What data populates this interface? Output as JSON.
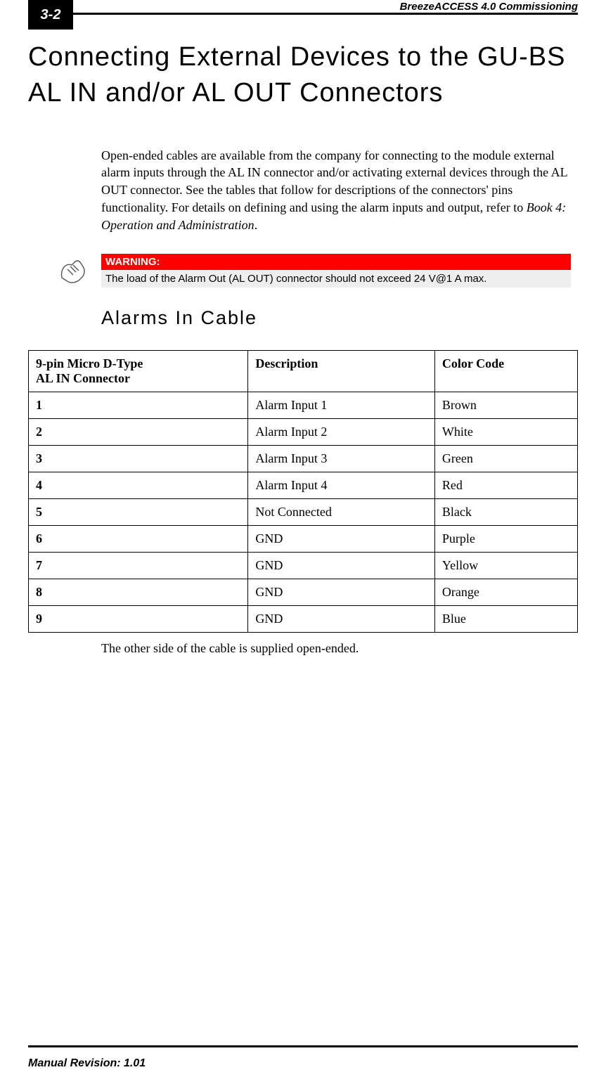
{
  "header": {
    "page_number": "3-2",
    "running_title": "BreezeACCESS 4.0 Commissioning"
  },
  "title": "Connecting External Devices to the GU-BS AL IN and/or AL OUT Connectors",
  "intro": {
    "text": "Open-ended cables are available from the company for connecting to the module external alarm inputs through the AL IN connector and/or activating external devices through the AL OUT connector. See the tables that follow for descriptions of the connectors' pins functionality. For details on defining and using the alarm inputs and output, refer to ",
    "ref": "Book 4: Operation and Administration",
    "end": "."
  },
  "warning": {
    "label": "WARNING:",
    "text": "The load of the Alarm Out (AL OUT) connector should not exceed 24 V@1 A max."
  },
  "section_title": "Alarms In Cable",
  "table": {
    "headers": {
      "col1a": "9-pin Micro D-Type",
      "col1b": "AL IN Connector",
      "col2": "Description",
      "col3": "Color Code"
    },
    "rows": [
      {
        "pin": "1",
        "desc": "Alarm Input 1",
        "color": "Brown"
      },
      {
        "pin": "2",
        "desc": "Alarm Input 2",
        "color": "White"
      },
      {
        "pin": "3",
        "desc": "Alarm Input 3",
        "color": "Green"
      },
      {
        "pin": "4",
        "desc": "Alarm Input 4",
        "color": "Red"
      },
      {
        "pin": "5",
        "desc": "Not Connected",
        "color": "Black"
      },
      {
        "pin": "6",
        "desc": "GND",
        "color": "Purple"
      },
      {
        "pin": "7",
        "desc": "GND",
        "color": "Yellow"
      },
      {
        "pin": "8",
        "desc": "GND",
        "color": "Orange"
      },
      {
        "pin": "9",
        "desc": "GND",
        "color": "Blue"
      }
    ]
  },
  "closing": "The other side of the cable is supplied open-ended.",
  "footer": "Manual Revision: 1.01"
}
